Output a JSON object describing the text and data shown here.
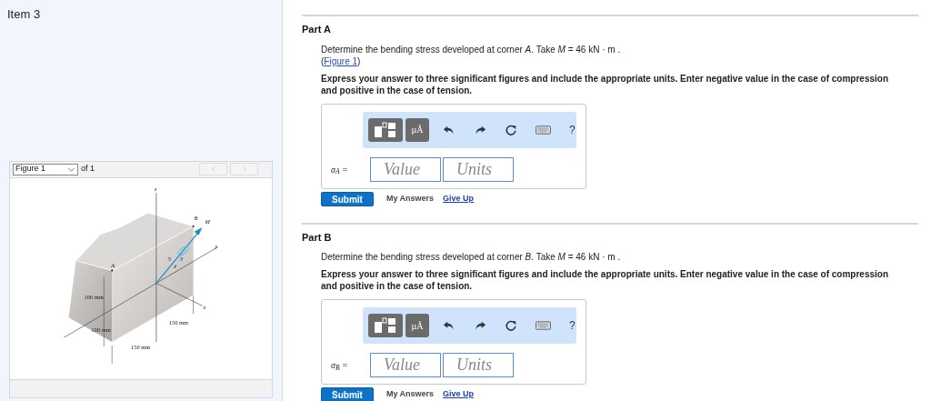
{
  "item_title": "Item 3",
  "figure_panel": {
    "select_value": "Figure 1",
    "of_text": "of 1",
    "prev_disabled": true,
    "next_disabled": true,
    "labels": [
      "z",
      "B",
      "M",
      "y",
      "A",
      "5",
      "3",
      "4",
      "x",
      "100 mm",
      "100 mm",
      "150 mm",
      "150 mm"
    ]
  },
  "parts": [
    {
      "title": "Part A",
      "prompt": "Determine the bending stress developed at corner *A*. Take *M* = 46 kN · m .",
      "figure_ref": {
        "open": "(",
        "link": "Figure 1",
        "close": ")"
      },
      "instruction": "Express your answer to three significant figures and include the appropriate units. Enter negative value in the case of compression and positive in the case of tension.",
      "toolbar": {
        "units_button": "µÅ",
        "help": "?"
      },
      "variable": "σ$_{A}$ =",
      "value_placeholder": "Value",
      "units_placeholder": "Units",
      "submit": "Submit",
      "my_answers": "My Answers",
      "give_up": "Give Up"
    },
    {
      "title": "Part B",
      "prompt": "Determine the bending stress developed at corner *B*. Take *M* = 46 kN · m .",
      "instruction": "Express your answer to three significant figures and include the appropriate units. Enter negative value in the case of compression and positive in the case of tension.",
      "toolbar": {
        "units_button": "µÅ",
        "help": "?"
      },
      "variable": "σ$_{B}$ =",
      "value_placeholder": "Value",
      "units_placeholder": "Units",
      "submit": "Submit",
      "my_answers": "My Answers",
      "give_up": "Give Up"
    }
  ]
}
